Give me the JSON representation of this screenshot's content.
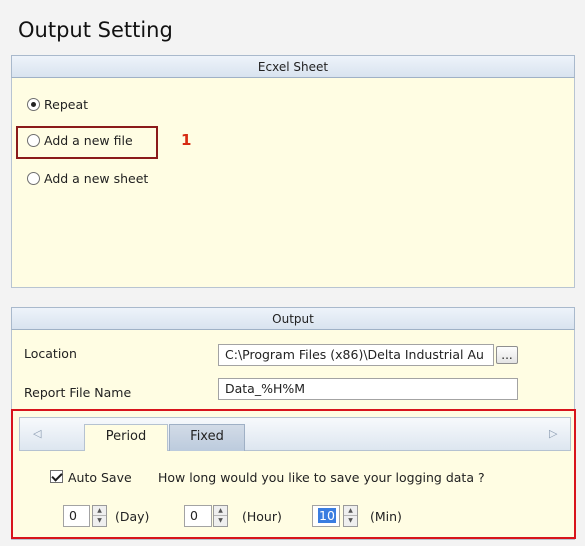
{
  "title": "Output Setting",
  "excel_sheet": {
    "header": "Ecxel Sheet",
    "options": [
      {
        "label": "Repeat",
        "checked": true
      },
      {
        "label": "Add a new file",
        "checked": false
      },
      {
        "label": "Add a new sheet",
        "checked": false
      }
    ],
    "callout": "1"
  },
  "output": {
    "header": "Output",
    "location_label": "Location",
    "location_value": "C:\\Program Files (x86)\\Delta Industrial Au",
    "browse_label": "...",
    "report_label": "Report File Name",
    "report_value": "Data_%H%M"
  },
  "tabs": {
    "left_arrow": "◁",
    "right_arrow": "▷",
    "items": [
      {
        "label": "Period",
        "active": true
      },
      {
        "label": "Fixed",
        "active": false
      }
    ]
  },
  "period": {
    "autosave_label": "Auto Save",
    "autosave_checked": true,
    "question": "How long would you like to save your logging data ?",
    "day_value": "0",
    "day_unit": "(Day)",
    "hour_value": "0",
    "hour_unit": "(Hour)",
    "min_value": "10",
    "min_unit": "(Min)"
  }
}
